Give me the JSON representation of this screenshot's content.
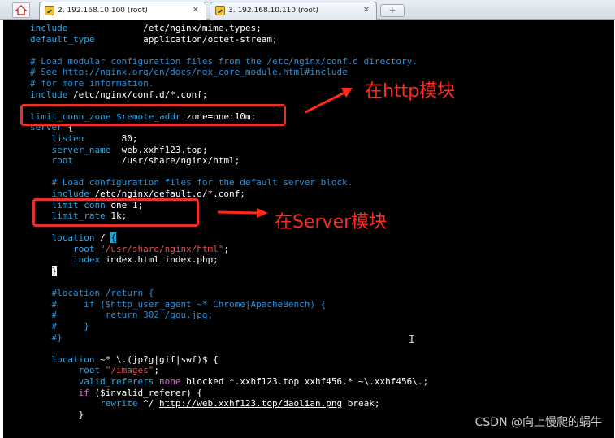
{
  "tabs": [
    {
      "label": "2. 192.168.10.100 (root)",
      "active": true
    },
    {
      "label": "3. 192.168.10.110 (root)",
      "active": false
    }
  ],
  "annotations": {
    "http_module": "在http模块",
    "server_module": "在Server模块"
  },
  "watermark": "CSDN @向上慢爬的蜗牛",
  "code": {
    "l1_a": "include",
    "l1_b": "/etc/nginx/mime.types;",
    "l2_a": "default_type",
    "l2_b": "application/octet-stream;",
    "c1": "# Load modular configuration files from the /etc/nginx/conf.d directory.",
    "c2": "# See http://nginx.org/en/docs/ngx_core_module.html#include",
    "c3": "# for more information.",
    "l6_a": "include",
    "l6_b": "/etc/nginx/conf.d/*.conf;",
    "lcz_a": "limit_conn_zone",
    "lcz_b": "$remote_addr",
    "lcz_c": "zone=one:10m;",
    "server": "server",
    "brace_open": "{",
    "listen_a": "listen",
    "listen_b": "80;",
    "sname_a": "server_name",
    "sname_b": "web.xxhf123.top;",
    "root_a": "root",
    "root_b": "/usr/share/nginx/html;",
    "c4": "# Load configuration files for the default server block.",
    "inc_a": "include",
    "inc_b": "/etc/nginx/default.d/*.conf;",
    "lc_a": "limit_conn",
    "lc_b": "one 1;",
    "lr_a": "limit_rate",
    "lr_b": "1k;",
    "loc1_a": "location",
    "loc1_b": "/",
    "loc1_c": "{",
    "root2_a": "root",
    "root2_b": "\"/usr/share/nginx/html\"",
    "root2_c": ";",
    "index_a": "index",
    "index_b": "index.html index.php;",
    "brace_close1": "}",
    "c5": "#location /return {",
    "c6": "#     if ($http_user_agent ~* Chrome|ApacheBench) {",
    "c7": "#         return 302 /gou.jpg;",
    "c8": "#     }",
    "c9": "#}",
    "loc2_a": "location",
    "loc2_b": "~* \\.(jp?g|gif|swf)$ {",
    "root3_a": "root",
    "root3_b": "\"/images\"",
    "root3_c": ";",
    "vr_a": "valid_referers",
    "vr_b": "none",
    "vr_c": "blocked *.xxhf123.top xxhf456.* ~\\.xxhf456\\.;",
    "if_a": "if",
    "if_b": "($invalid_referer) {",
    "rw_a": "rewrite",
    "rw_b": "^/",
    "rw_c": "http://web.xxhf123.top/daolian.png",
    "rw_d": "break;",
    "brace_close2": "}"
  }
}
